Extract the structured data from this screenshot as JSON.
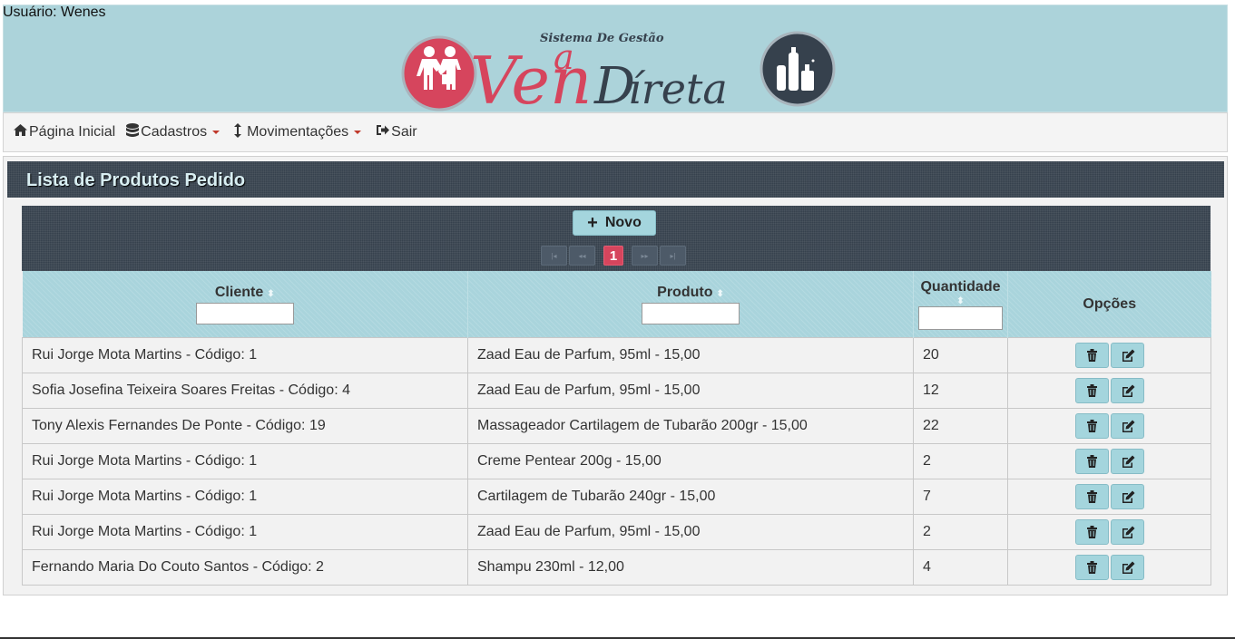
{
  "user": {
    "label": "Usuário: Wenes"
  },
  "logo": {
    "line1": "Sistema De Gestão",
    "ven": "Ven",
    "da": "Da",
    "direta": "Direta"
  },
  "nav": {
    "items": [
      {
        "label": "Página Inicial",
        "icon": "home-icon"
      },
      {
        "label": "Cadastros",
        "icon": "database-icon",
        "dropdown": true
      },
      {
        "label": "Movimentações",
        "icon": "vertical-arrows-icon",
        "dropdown": true
      },
      {
        "label": "Sair",
        "icon": "sign-out-icon"
      }
    ]
  },
  "panel": {
    "title": "Lista de Produtos Pedido"
  },
  "toolbar": {
    "new_label": "Novo",
    "pager": {
      "first": "|◂",
      "prev": "◂◂",
      "current": "1",
      "next": "▸▸",
      "last": "▸|"
    }
  },
  "table": {
    "headers": {
      "cliente": "Cliente",
      "produto": "Produto",
      "quantidade": "Quantidade",
      "opcoes": "Opções"
    },
    "rows": [
      {
        "cliente": "Rui Jorge Mota Martins - Código: 1",
        "produto": "Zaad Eau de Parfum, 95ml - 15,00",
        "quantidade": "20"
      },
      {
        "cliente": "Sofia Josefina Teixeira Soares Freitas - Código: 4",
        "produto": "Zaad Eau de Parfum, 95ml - 15,00",
        "quantidade": "12"
      },
      {
        "cliente": "Tony Alexis Fernandes De Ponte - Código: 19",
        "produto": "Massageador Cartilagem de Tubarão 200gr - 15,00",
        "quantidade": "22"
      },
      {
        "cliente": "Rui Jorge Mota Martins - Código: 1",
        "produto": "Creme Pentear 200g - 15,00",
        "quantidade": "2"
      },
      {
        "cliente": "Rui Jorge Mota Martins - Código: 1",
        "produto": "Cartilagem de Tubarão 240gr - 15,00",
        "quantidade": "7"
      },
      {
        "cliente": "Rui Jorge Mota Martins - Código: 1",
        "produto": "Zaad Eau de Parfum, 95ml - 15,00",
        "quantidade": "2"
      },
      {
        "cliente": "Fernando Maria Do Couto Santos - Código: 2",
        "produto": "Shampu 230ml - 12,00",
        "quantidade": "4"
      }
    ]
  },
  "colors": {
    "banner": "#acd3da",
    "header": "#36414d",
    "accent": "#a4d5dd",
    "active_page": "#d6455d",
    "logo_red": "#d6455d",
    "logo_dark": "#36414d"
  }
}
